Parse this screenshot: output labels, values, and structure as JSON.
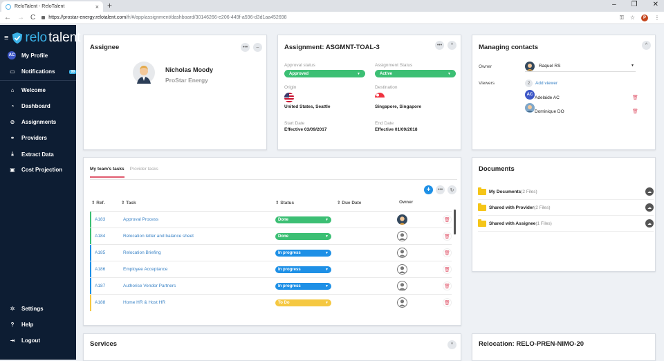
{
  "browser": {
    "tab_title": "ReloTalent - ReloTalent",
    "url_host": "https://prostar-energy.relotalent.com",
    "url_path": "/fr/#/app/assignment/dashboard/30146266-e206-449f-a596-d3d1aa452698",
    "profile_initial": "P"
  },
  "sidebar": {
    "logo_part1": "relo",
    "logo_part2": "talent",
    "profile": {
      "initials": "AC",
      "label": "My Profile"
    },
    "notifications": {
      "label": "Notifications",
      "badge": "99"
    },
    "items": [
      {
        "label": "Welcome"
      },
      {
        "label": "Dashboard"
      },
      {
        "label": "Assignments"
      },
      {
        "label": "Providers"
      },
      {
        "label": "Extract Data"
      },
      {
        "label": "Cost Projection"
      }
    ],
    "bottom": [
      {
        "label": "Settings"
      },
      {
        "label": "Help"
      },
      {
        "label": "Logout"
      }
    ]
  },
  "assignee": {
    "title": "Assignee",
    "name": "Nicholas Moody",
    "company": "ProStar Energy"
  },
  "assignment": {
    "title": "Assignment: ASGMNT-TOAL-3",
    "approval_label": "Approval status",
    "approval_value": "Approved",
    "status_label": "Assignment Status",
    "status_value": "Active",
    "origin_label": "Origin",
    "origin_value": "United States, Seattle",
    "destination_label": "Destination",
    "destination_value": "Singapore, Singapore",
    "start_label": "Start Date",
    "start_value": "Effective 03/09/2017",
    "end_label": "End Date",
    "end_value": "Effective 01/09/2018"
  },
  "contacts": {
    "title": "Managing contacts",
    "owner_label": "Owner",
    "owner_name": "Raquel RS",
    "viewers_label": "Viewers",
    "add_viewer_count": "2",
    "add_viewer_label": "Add viewer",
    "viewers": [
      {
        "initials": "AC",
        "name": "Adelaide AC"
      },
      {
        "initials": "",
        "name": "Dominique DO"
      }
    ]
  },
  "tasks": {
    "tab_active": "My team's tasks",
    "tab_inactive": "Provider tasks",
    "col_ref": "⇕ Ref.",
    "col_task": "⇕ Task",
    "col_status": "⇕ Status",
    "col_due": "⇕ Due Date",
    "col_owner": "Owner",
    "rows": [
      {
        "ref": "A183",
        "task": "Approval Process",
        "status": "Done",
        "color": "#3cbf74"
      },
      {
        "ref": "A184",
        "task": "Relocation letter and balance sheet",
        "status": "Done",
        "color": "#3cbf74"
      },
      {
        "ref": "A185",
        "task": "Relocation Briefing",
        "status": "In progress",
        "color": "#1e90e6"
      },
      {
        "ref": "A186",
        "task": "Employee Acceptance",
        "status": "In progress",
        "color": "#1e90e6"
      },
      {
        "ref": "A187",
        "task": "Authorise Vendor Partners",
        "status": "In progress",
        "color": "#1e90e6"
      },
      {
        "ref": "A188",
        "task": "Home HR & Host HR",
        "status": "To Do",
        "color": "#f5c842"
      }
    ]
  },
  "documents": {
    "title": "Documents",
    "folders": [
      {
        "name": "My Documents",
        "count": "(2 Files)"
      },
      {
        "name": "Shared with Provider",
        "count": "(2 Files)"
      },
      {
        "name": "Shared with Assignee",
        "count": "(1 Files)"
      }
    ]
  },
  "services": {
    "title": "Services"
  },
  "relocation": {
    "title": "Relocation: RELO-PREN-NIMO-20"
  }
}
